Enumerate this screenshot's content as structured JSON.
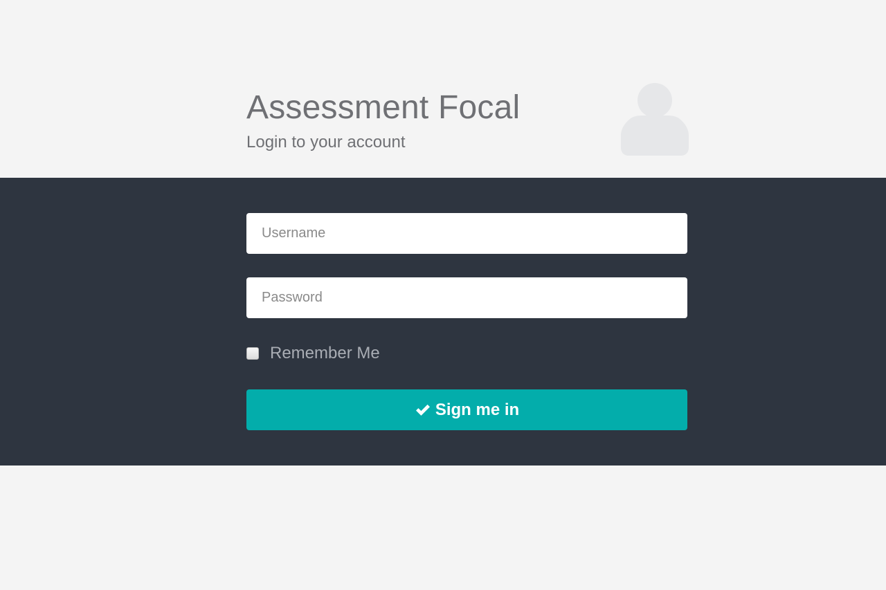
{
  "header": {
    "title": "Assessment Focal",
    "subtitle": "Login to your account",
    "avatar_icon": "user-icon"
  },
  "form": {
    "username": {
      "placeholder": "Username",
      "value": ""
    },
    "password": {
      "placeholder": "Password",
      "value": ""
    },
    "remember": {
      "label": "Remember Me",
      "checked": false
    },
    "submit": {
      "label": "Sign me in",
      "icon": "check-icon"
    }
  },
  "colors": {
    "background": "#f4f4f4",
    "band": "#2e3540",
    "accent": "#03adab",
    "title_text": "#6f7074"
  }
}
